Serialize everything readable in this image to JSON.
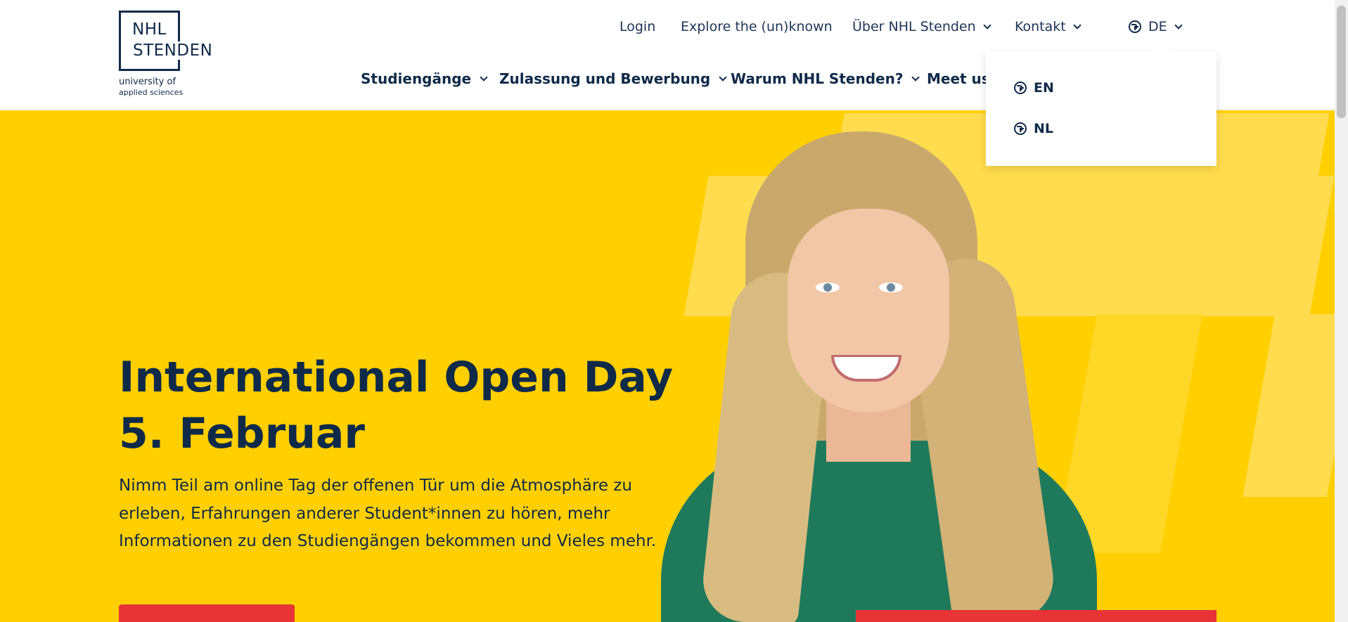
{
  "logo": {
    "line1": "NHL",
    "line2": "STENDEN",
    "sub1": "university of",
    "sub2": "applied sciences"
  },
  "topnav": {
    "login": "Login",
    "explore": "Explore the (un)known",
    "about": "Über NHL Stenden",
    "contact": "Kontakt",
    "language": "DE"
  },
  "mainnav": {
    "items": [
      "Studiengänge",
      "Zulassung und Bewerbung",
      "Warum NHL Stenden?",
      "Meet us"
    ]
  },
  "language_dropdown": {
    "options": [
      "EN",
      "NL"
    ]
  },
  "hero": {
    "title_line1": "International Open Day",
    "title_line2": "5. Februar",
    "text": "Nimm Teil am online Tag der offenen Tür um die Atmosphäre zu erleben, Erfahrungen anderer Student*innen zu hören, mehr Informationen zu den Studiengängen bekommen und Vieles mehr."
  },
  "colors": {
    "navy": "#0f2a49",
    "yellow": "#ffcf00",
    "red": "#e83337"
  },
  "icons": {
    "globe": "globe-icon",
    "chevron": "chevron-down-icon"
  }
}
